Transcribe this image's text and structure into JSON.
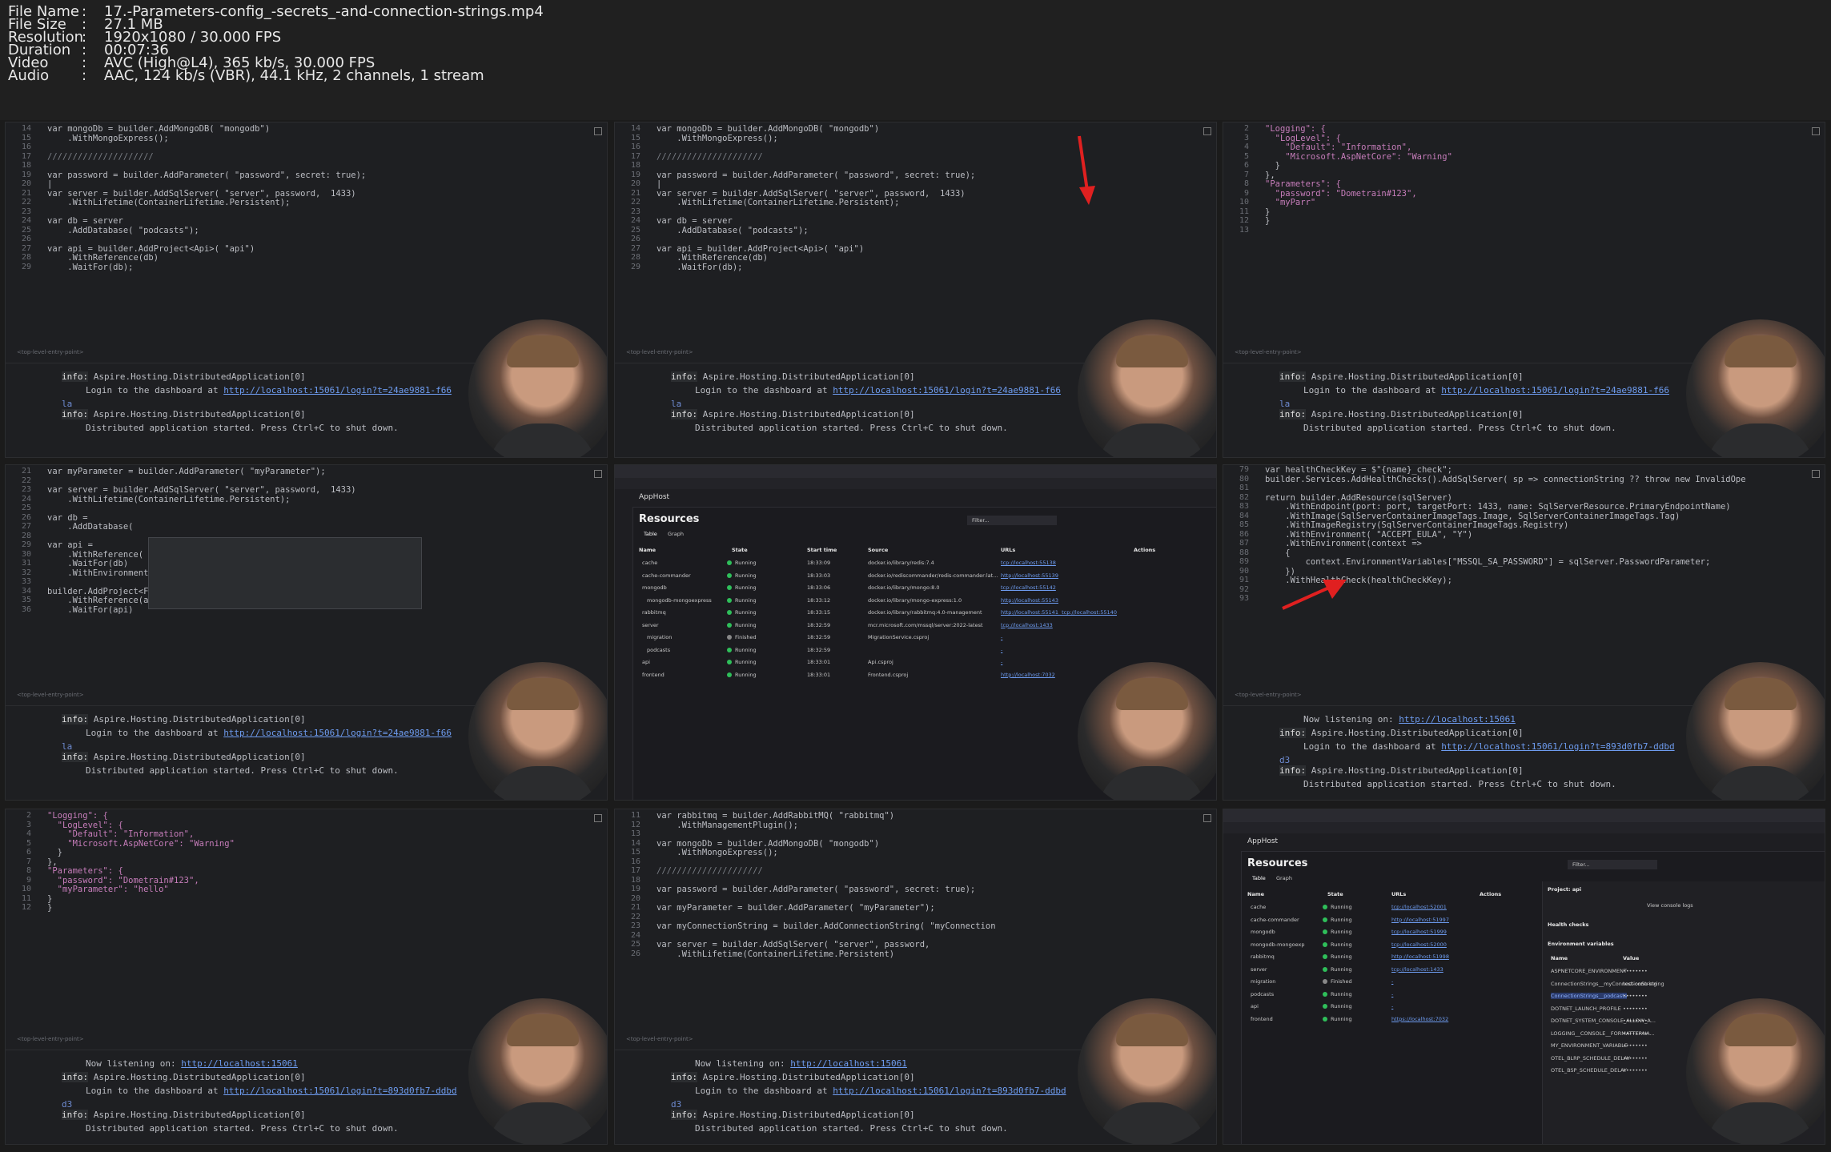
{
  "meta": [
    {
      "label": "File Name",
      "value": "17.-Parameters-config_-secrets_-and-connection-strings.mp4"
    },
    {
      "label": "File Size",
      "value": "27.1 MB"
    },
    {
      "label": "Resolution",
      "value": "1920x1080 / 30.000 FPS"
    },
    {
      "label": "Duration",
      "value": "00:07:36"
    },
    {
      "label": "Video",
      "value": "AVC (High@L4), 365 kb/s, 30.000 FPS"
    },
    {
      "label": "Audio",
      "value": "AAC, 124 kb/s (VBR), 44.1 kHz, 2 channels, 1 stream"
    }
  ],
  "sep": ":",
  "term": {
    "info": "info:",
    "hosting": "Aspire.Hosting.DistributedApplication[0]",
    "login_prefix": "Login to the dashboard at ",
    "login_a": "http://localhost:15061/login?t=24ae9881-f66",
    "login_b": "http://localhost:15061/login?t=893d0fb7-ddbd",
    "started": "Distributed application started. Press Ctrl+C to shut down.",
    "listening_prefix": "Now listening on: ",
    "listening_url": "http://localhost:15061",
    "la": "la",
    "d3": "d3"
  },
  "code1": [
    {
      "n": "14",
      "t": "var mongoDb = builder.AddMongoDB( \"mongodb\")"
    },
    {
      "n": "15",
      "t": "    .WithMongoExpress();"
    },
    {
      "n": "16",
      "t": ""
    },
    {
      "n": "17",
      "t": "/////////////////////"
    },
    {
      "n": "18",
      "t": ""
    },
    {
      "n": "19",
      "t": "var password = builder.AddParameter( \"password\", secret: true);"
    },
    {
      "n": "20",
      "t": "|"
    },
    {
      "n": "21",
      "t": "var server = builder.AddSqlServer( \"server\", password,  1433)"
    },
    {
      "n": "22",
      "t": "    .WithLifetime(ContainerLifetime.Persistent);"
    },
    {
      "n": "23",
      "t": ""
    },
    {
      "n": "24",
      "t": "var db = server"
    },
    {
      "n": "25",
      "t": "    .AddDatabase( \"podcasts\");"
    },
    {
      "n": "26",
      "t": ""
    },
    {
      "n": "27",
      "t": "var api = builder.AddProject<Api>( \"api\")"
    },
    {
      "n": "28",
      "t": "    .WithReference(db)"
    },
    {
      "n": "29",
      "t": "    .WaitFor(db);"
    }
  ],
  "code3": [
    {
      "n": "2",
      "t": "\"Logging\": {"
    },
    {
      "n": "3",
      "t": "  \"LogLevel\": {"
    },
    {
      "n": "4",
      "t": "    \"Default\": \"Information\","
    },
    {
      "n": "5",
      "t": "    \"Microsoft.AspNetCore\": \"Warning\""
    },
    {
      "n": "6",
      "t": "  }"
    },
    {
      "n": "7",
      "t": "},"
    },
    {
      "n": "8",
      "t": "\"Parameters\": {"
    },
    {
      "n": "9",
      "t": "  \"password\": \"Dometrain#123\","
    },
    {
      "n": "10",
      "t": "  \"myParr\""
    },
    {
      "n": "11",
      "t": "}"
    },
    {
      "n": "12",
      "t": "}"
    },
    {
      "n": "13",
      "t": ""
    }
  ],
  "code4": [
    {
      "n": "21",
      "t": "var myParameter = builder.AddParameter( \"myParameter\");"
    },
    {
      "n": "22",
      "t": ""
    },
    {
      "n": "23",
      "t": "var server = builder.AddSqlServer( \"server\", password,  1433)"
    },
    {
      "n": "24",
      "t": "    .WithLifetime(ContainerLifetime.Persistent);"
    },
    {
      "n": "25",
      "t": ""
    },
    {
      "n": "26",
      "t": "var db ="
    },
    {
      "n": "27",
      "t": "    .AddDatabase("
    },
    {
      "n": "28",
      "t": ""
    },
    {
      "n": "29",
      "t": "var api ="
    },
    {
      "n": "30",
      "t": "    .WithReference("
    },
    {
      "n": "31",
      "t": "    .WaitFor(db)"
    },
    {
      "n": "32",
      "t": "    .WithEnvironment()"
    },
    {
      "n": "33",
      "t": ""
    },
    {
      "n": "34",
      "t": "builder.AddProject<Frontend>( \"frontend\")"
    },
    {
      "n": "35",
      "t": "    .WithReference(api)"
    },
    {
      "n": "36",
      "t": "    .WaitFor(api)"
    }
  ],
  "code6": [
    {
      "n": "79",
      "t": "var healthCheckKey = $\"{name}_check\";"
    },
    {
      "n": "80",
      "t": "builder.Services.AddHealthChecks().AddSqlServer( sp => connectionString ?? throw new InvalidOpe"
    },
    {
      "n": "81",
      "t": ""
    },
    {
      "n": "82",
      "t": "return builder.AddResource(sqlServer)"
    },
    {
      "n": "83",
      "t": "    .WithEndpoint(port: port, targetPort: 1433, name: SqlServerResource.PrimaryEndpointName)"
    },
    {
      "n": "84",
      "t": "    .WithImage(SqlServerContainerImageTags.Image, SqlServerContainerImageTags.Tag)"
    },
    {
      "n": "85",
      "t": "    .WithImageRegistry(SqlServerContainerImageTags.Registry)"
    },
    {
      "n": "86",
      "t": "    .WithEnvironment( \"ACCEPT_EULA\", \"Y\")"
    },
    {
      "n": "87",
      "t": "    .WithEnvironment(context =>"
    },
    {
      "n": "88",
      "t": "    {"
    },
    {
      "n": "89",
      "t": "        context.EnvironmentVariables[\"MSSQL_SA_PASSWORD\"] = sqlServer.PasswordParameter;"
    },
    {
      "n": "90",
      "t": "    })"
    },
    {
      "n": "91",
      "t": "    .WithHealthCheck(healthCheckKey);"
    },
    {
      "n": "92",
      "t": ""
    },
    {
      "n": "93",
      "t": ""
    }
  ],
  "code7": [
    {
      "n": "2",
      "t": "\"Logging\": {"
    },
    {
      "n": "3",
      "t": "  \"LogLevel\": {"
    },
    {
      "n": "4",
      "t": "    \"Default\": \"Information\","
    },
    {
      "n": "5",
      "t": "    \"Microsoft.AspNetCore\": \"Warning\""
    },
    {
      "n": "6",
      "t": "  }"
    },
    {
      "n": "7",
      "t": "},"
    },
    {
      "n": "8",
      "t": "\"Parameters\": {"
    },
    {
      "n": "9",
      "t": "  \"password\": \"Dometrain#123\","
    },
    {
      "n": "10",
      "t": "  \"myParameter\": \"hello\""
    },
    {
      "n": "11",
      "t": "}"
    },
    {
      "n": "12",
      "t": "}"
    }
  ],
  "code8": [
    {
      "n": "11",
      "t": "var rabbitmq = builder.AddRabbitMQ( \"rabbitmq\")"
    },
    {
      "n": "12",
      "t": "    .WithManagementPlugin();"
    },
    {
      "n": "13",
      "t": ""
    },
    {
      "n": "14",
      "t": "var mongoDb = builder.AddMongoDB( \"mongodb\")"
    },
    {
      "n": "15",
      "t": "    .WithMongoExpress();"
    },
    {
      "n": "16",
      "t": ""
    },
    {
      "n": "17",
      "t": "/////////////////////"
    },
    {
      "n": "18",
      "t": ""
    },
    {
      "n": "19",
      "t": "var password = builder.AddParameter( \"password\", secret: true);"
    },
    {
      "n": "20",
      "t": ""
    },
    {
      "n": "21",
      "t": "var myParameter = builder.AddParameter( \"myParameter\");"
    },
    {
      "n": "22",
      "t": ""
    },
    {
      "n": "23",
      "t": "var myConnectionString = builder.AddConnectionString( \"myConnection"
    },
    {
      "n": "24",
      "t": ""
    },
    {
      "n": "25",
      "t": "var server = builder.AddSqlServer( \"server\", password,"
    },
    {
      "n": "26",
      "t": "    .WithLifetime(ContainerLifetime.Persistent)"
    }
  ],
  "dash": {
    "app": "AppHost",
    "title": "Resources",
    "filter": "Filter...",
    "tab_table": "Table",
    "tab_graph": "Graph",
    "cols": [
      "Name",
      "State",
      "Start time",
      "Source",
      "URLs",
      "Actions"
    ],
    "rows": [
      {
        "name": "cache",
        "state": "Running",
        "start": "18:33:09",
        "source": "docker.io/library/redis:7.4",
        "url": "tcp://localhost:55138"
      },
      {
        "name": "cache-commander",
        "state": "Running",
        "start": "18:33:03",
        "source": "docker.io/rediscommander/redis-commander:lat...",
        "url": "http://localhost:55139"
      },
      {
        "name": "mongodb",
        "state": "Running",
        "start": "18:33:06",
        "source": "docker.io/library/mongo:8.0",
        "url": "tcp://localhost:55142"
      },
      {
        "name": "mongodb-mongoexpress",
        "state": "Running",
        "start": "18:33:12",
        "source": "docker.io/library/mongo-express:1.0",
        "url": "http://localhost:55143"
      },
      {
        "name": "rabbitmq",
        "state": "Running",
        "start": "18:33:15",
        "source": "docker.io/library/rabbitmq:4.0-management",
        "url": "http://localhost:55141  tcp://localhost:55140"
      },
      {
        "name": "server",
        "state": "Running",
        "start": "18:32:59",
        "source": "mcr.microsoft.com/mssql/server:2022-latest",
        "url": "tcp://localhost:1433"
      },
      {
        "name": "migration",
        "state": "Finished",
        "start": "18:32:59",
        "source": "MigrationService.csproj",
        "url": "-"
      },
      {
        "name": "podcasts",
        "state": "Running",
        "start": "18:32:59",
        "source": "",
        "url": "-"
      },
      {
        "name": "api",
        "state": "Running",
        "start": "18:33:01",
        "source": "Api.csproj",
        "url": "-"
      },
      {
        "name": "frontend",
        "state": "Running",
        "start": "18:33:01",
        "source": "Frontend.csproj",
        "url": "http://localhost:7032"
      }
    ],
    "cols2": [
      "Name",
      "State",
      "URLs",
      "Actions"
    ],
    "rows2": [
      {
        "name": "cache",
        "state": "Running",
        "url": "tcp://localhost:52001"
      },
      {
        "name": "cache-commander",
        "state": "Running",
        "url": "http://localhost:51997"
      },
      {
        "name": "mongodb",
        "state": "Running",
        "url": "tcp://localhost:51999"
      },
      {
        "name": "mongodb-mongoexp",
        "state": "Running",
        "url": "tcp://localhost:52000"
      },
      {
        "name": "rabbitmq",
        "state": "Running",
        "url": "http://localhost:51998"
      },
      {
        "name": "server",
        "state": "Running",
        "url": "tcp://localhost:1433"
      },
      {
        "name": "migration",
        "state": "Finished",
        "url": "-"
      },
      {
        "name": "podcasts",
        "state": "Running",
        "url": "-"
      },
      {
        "name": "api",
        "state": "Running",
        "url": "-"
      },
      {
        "name": "frontend",
        "state": "Running",
        "url": "https://localhost:7032"
      }
    ],
    "project": "Project: api",
    "view_logs": "View console logs",
    "health": "Health checks",
    "env": "Environment variables",
    "env_cols": [
      "Name",
      "Value"
    ],
    "env_rows": [
      {
        "name": "ASPNETCORE_ENVIRONMENT",
        "value": "••••••••"
      },
      {
        "name": "ConnectionStrings__myConnectionString",
        "value": "test-conn-string"
      },
      {
        "name": "ConnectionStrings__podcasts",
        "value": "••••••••"
      },
      {
        "name": "DOTNET_LAUNCH_PROFILE",
        "value": "••••••••"
      },
      {
        "name": "DOTNET_SYSTEM_CONSOLE_ALLOW_A...",
        "value": "••••••••"
      },
      {
        "name": "LOGGING__CONSOLE__FORMATTERNA...",
        "value": "••••••••"
      },
      {
        "name": "MY_ENVIRONMENT_VARIABLE",
        "value": "••••••••"
      },
      {
        "name": "OTEL_BLRP_SCHEDULE_DELAY",
        "value": "••••••••"
      },
      {
        "name": "OTEL_BSP_SCHEDULE_DELAY",
        "value": "••••••••"
      }
    ]
  },
  "colors": {
    "accent_red": "#e02020",
    "running": "#2fbf5a",
    "link": "#6e9cf0"
  }
}
